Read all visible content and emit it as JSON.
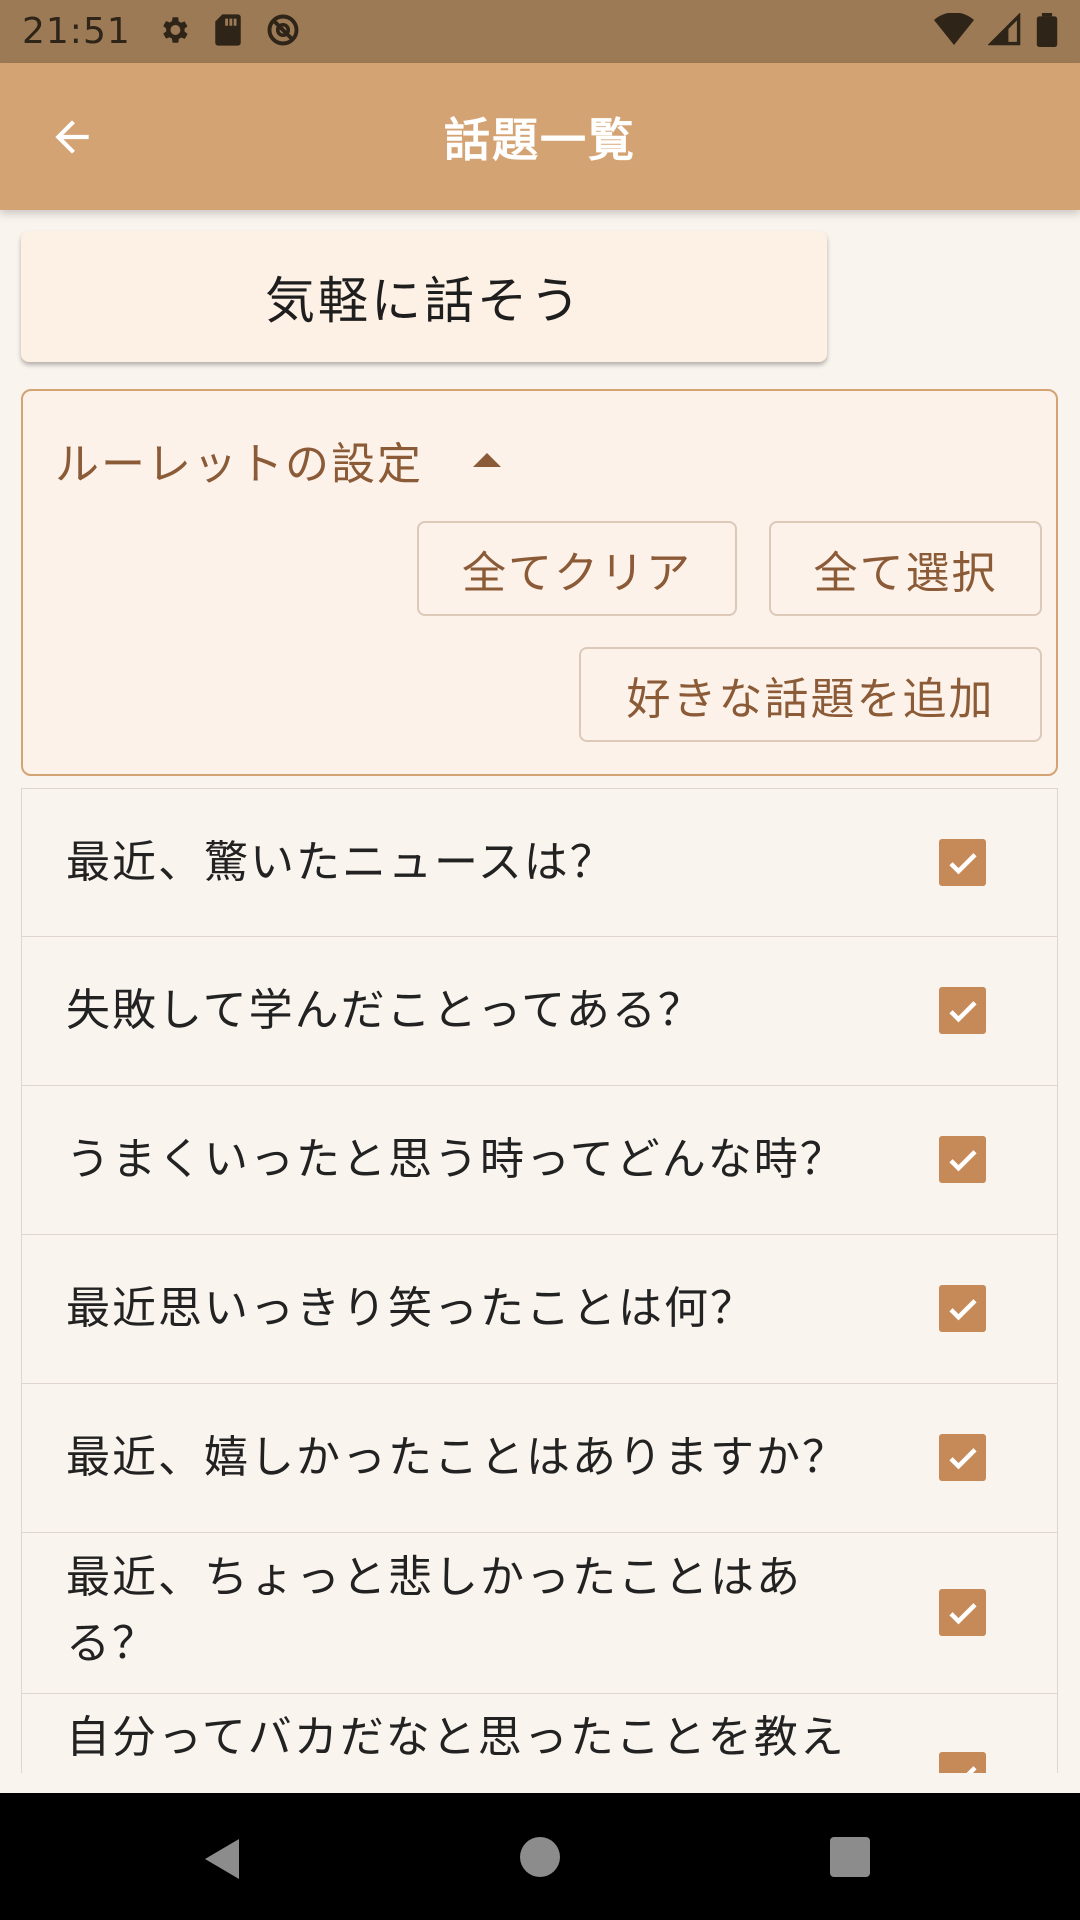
{
  "status_bar": {
    "time": "21:51"
  },
  "app_bar": {
    "title": "話題一覧"
  },
  "main_button": {
    "label": "気軽に話そう"
  },
  "settings": {
    "label": "ルーレットの設定",
    "clear_all": "全てクリア",
    "select_all": "全て選択",
    "add_topic": "好きな話題を追加"
  },
  "topics": [
    {
      "text": "最近、驚いたニュースは？",
      "checked": true
    },
    {
      "text": "失敗して学んだことってある？",
      "checked": true
    },
    {
      "text": "うまくいったと思う時ってどんな時？",
      "checked": true
    },
    {
      "text": "最近思いっきり笑ったことは何？",
      "checked": true
    },
    {
      "text": "最近、嬉しかったことはありますか？",
      "checked": true
    },
    {
      "text": "最近、ちょっと悲しかったことはある？",
      "checked": true
    },
    {
      "text": "自分ってバカだなと思ったことを教え",
      "checked": true
    }
  ],
  "colors": {
    "accent": "#d4a373",
    "checkbox": "#c68a59",
    "label_brown": "#8b5a36"
  }
}
